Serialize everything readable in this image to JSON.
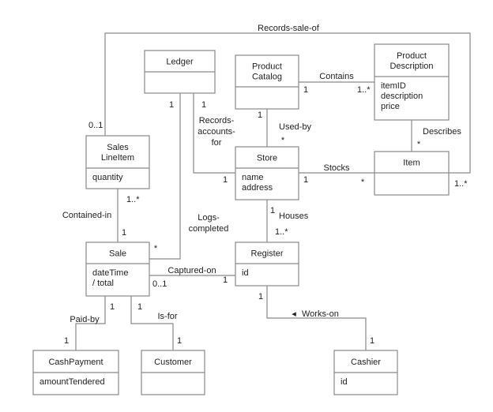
{
  "classes": {
    "ledger": {
      "name": [
        "Ledger"
      ],
      "attributes": []
    },
    "product_catalog": {
      "name": [
        "Product",
        "Catalog"
      ],
      "attributes": []
    },
    "product_description": {
      "name": [
        "Product",
        "Description"
      ],
      "attributes": [
        "itemID",
        "description",
        "price"
      ]
    },
    "sales_line_item": {
      "name": [
        "Sales",
        "LineItem"
      ],
      "attributes": [
        "quantity"
      ]
    },
    "store": {
      "name": [
        "Store"
      ],
      "attributes": [
        "name",
        "address"
      ]
    },
    "item": {
      "name": [
        "Item"
      ],
      "attributes": []
    },
    "sale": {
      "name": [
        "Sale"
      ],
      "attributes": [
        "dateTime",
        "/ total"
      ]
    },
    "register": {
      "name": [
        "Register"
      ],
      "attributes": [
        "id"
      ]
    },
    "cash_payment": {
      "name": [
        "CashPayment"
      ],
      "attributes": [
        "amountTendered"
      ]
    },
    "customer": {
      "name": [
        "Customer"
      ],
      "attributes": []
    },
    "cashier": {
      "name": [
        "Cashier"
      ],
      "attributes": [
        "id"
      ]
    }
  },
  "associations": {
    "records_sale_of": {
      "label": [
        "Records-sale-of"
      ],
      "mult": [
        "0..1",
        "1..*"
      ]
    },
    "records_accounts_for": {
      "label": [
        "Records-",
        "accounts-",
        "for"
      ],
      "mult": [
        "1",
        "1"
      ]
    },
    "logs_completed": {
      "label": [
        "Logs-",
        "completed"
      ],
      "mult": [
        "1",
        "*"
      ]
    },
    "contains": {
      "label": [
        "Contains"
      ],
      "mult": [
        "1",
        "1..*"
      ]
    },
    "used_by": {
      "label": [
        "Used-by"
      ],
      "mult": [
        "1",
        "*"
      ]
    },
    "describes": {
      "label": [
        "Describes"
      ],
      "mult": [
        "*"
      ]
    },
    "stocks": {
      "label": [
        "Stocks"
      ],
      "mult": [
        "1",
        "*"
      ]
    },
    "contained_in": {
      "label": [
        "Contained-in"
      ],
      "mult": [
        "1..*",
        "1"
      ]
    },
    "houses": {
      "label": [
        "Houses"
      ],
      "mult": [
        "1",
        "1..*"
      ]
    },
    "captured_on": {
      "label": [
        "Captured-on"
      ],
      "mult": [
        "0..1",
        "1"
      ]
    },
    "paid_by": {
      "label": [
        "Paid-by"
      ],
      "mult": [
        "1",
        "1"
      ]
    },
    "is_for": {
      "label": [
        "Is-for"
      ],
      "mult": [
        "1",
        "1"
      ]
    },
    "works_on": {
      "label": [
        "Works-on"
      ],
      "mult": [
        "1",
        "1"
      ],
      "direction_arrow": "◂"
    }
  }
}
